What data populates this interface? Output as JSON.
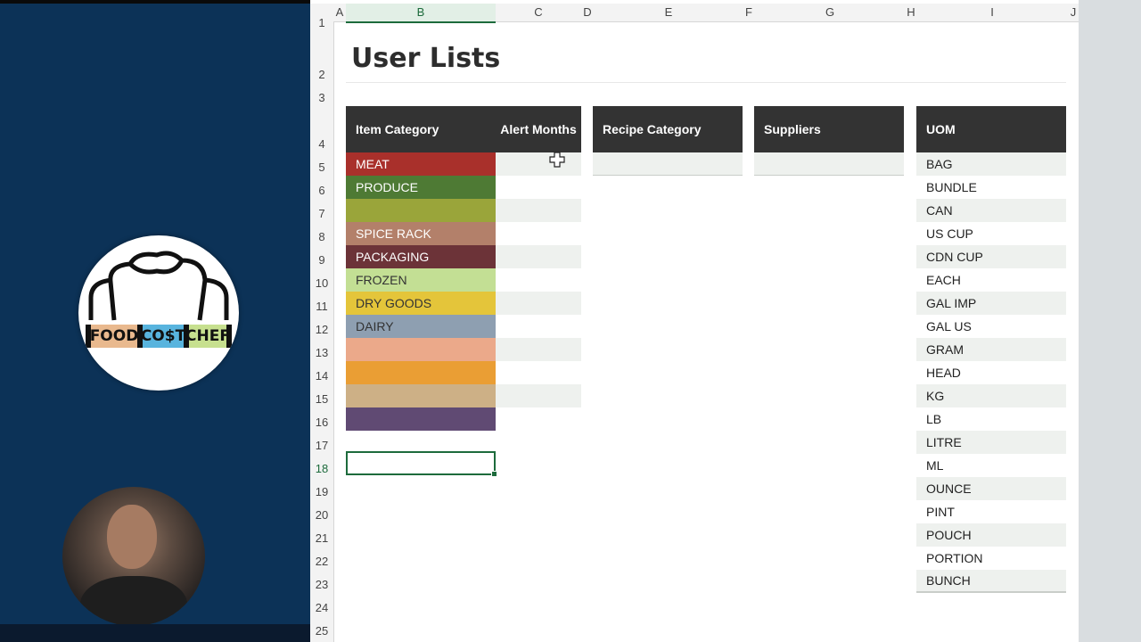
{
  "logo": {
    "words": [
      "FOOD",
      "CO$T",
      "CHEF"
    ]
  },
  "columns": [
    "A",
    "B",
    "C",
    "D",
    "E",
    "F",
    "G",
    "H",
    "I",
    "J"
  ],
  "active_column": "B",
  "rows": [
    "1",
    "2",
    "3",
    "4",
    "5",
    "6",
    "7",
    "8",
    "9",
    "10",
    "11",
    "12",
    "13",
    "14",
    "15",
    "16",
    "17",
    "18",
    "19",
    "20",
    "21",
    "22",
    "23",
    "24",
    "25"
  ],
  "active_row": "18",
  "title": "User Lists",
  "headers": {
    "item_category": "Item Category",
    "alert_months": "Alert Months",
    "recipe_category": "Recipe Category",
    "suppliers": "Suppliers",
    "uom": "UOM"
  },
  "item_categories": [
    {
      "label": "MEAT",
      "color": "#a9302b",
      "text": "#ffffff"
    },
    {
      "label": "PRODUCE",
      "color": "#4e7a34",
      "text": "#ffffff"
    },
    {
      "label": "",
      "color": "#9aa53a",
      "text": "#ffffff"
    },
    {
      "label": "SPICE RACK",
      "color": "#b3806a",
      "text": "#ffffff"
    },
    {
      "label": "PACKAGING",
      "color": "#6c3338",
      "text": "#ffffff"
    },
    {
      "label": "FROZEN",
      "color": "#c3df94",
      "text": "#333333"
    },
    {
      "label": "DRY GOODS",
      "color": "#e4c53a",
      "text": "#333333"
    },
    {
      "label": "DAIRY",
      "color": "#8e9fb1",
      "text": "#333333"
    },
    {
      "label": "",
      "color": "#eba98a",
      "text": "#333333"
    },
    {
      "label": "",
      "color": "#ea9e34",
      "text": "#333333"
    },
    {
      "label": "",
      "color": "#cdb086",
      "text": "#333333"
    },
    {
      "label": "",
      "color": "#604a73",
      "text": "#ffffff"
    }
  ],
  "uom": [
    "BAG",
    "BUNDLE",
    "CAN",
    "US CUP",
    "CDN CUP",
    "EACH",
    "GAL IMP",
    "GAL US",
    "GRAM",
    "HEAD",
    "KG",
    "LB",
    "LITRE",
    "ML",
    "OUNCE",
    "PINT",
    "POUCH",
    "PORTION",
    "BUNCH"
  ],
  "colors": {
    "header_bg": "#333333",
    "band": "#eef1ee",
    "accent": "#1d6b3c"
  }
}
